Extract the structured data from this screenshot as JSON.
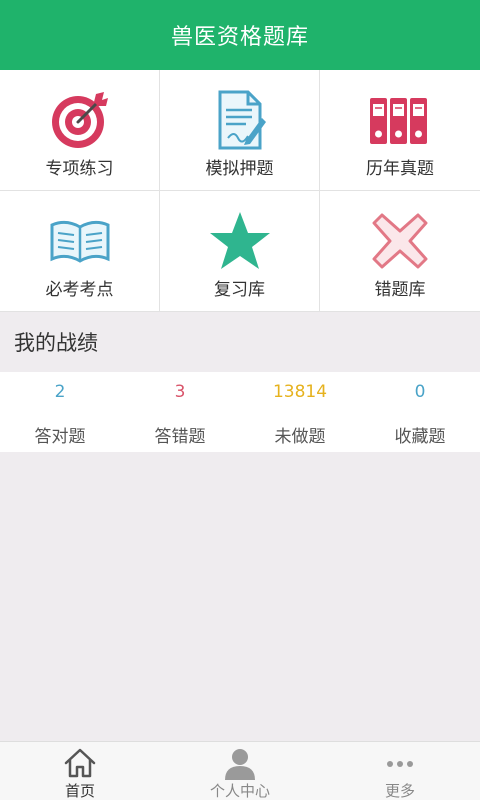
{
  "header": {
    "title": "兽医资格题库"
  },
  "grid": {
    "items": [
      {
        "label": "专项练习",
        "icon": "target-icon"
      },
      {
        "label": "模拟押题",
        "icon": "document-pen-icon"
      },
      {
        "label": "历年真题",
        "icon": "binders-icon"
      },
      {
        "label": "必考考点",
        "icon": "open-book-icon"
      },
      {
        "label": "复习库",
        "icon": "star-icon"
      },
      {
        "label": "错题库",
        "icon": "cross-icon"
      }
    ]
  },
  "record": {
    "title": "我的战绩",
    "stats": [
      {
        "value": "2",
        "label": "答对题",
        "color": "#4aa3c8"
      },
      {
        "value": "3",
        "label": "答错题",
        "color": "#d9546a"
      },
      {
        "value": "13814",
        "label": "未做题",
        "color": "#e6b21e"
      },
      {
        "value": "0",
        "label": "收藏题",
        "color": "#4aa3c8"
      }
    ]
  },
  "nav": {
    "items": [
      {
        "label": "首页",
        "icon": "home-icon",
        "active": true
      },
      {
        "label": "个人中心",
        "icon": "user-icon",
        "active": false
      },
      {
        "label": "更多",
        "icon": "more-dots-icon",
        "active": false
      }
    ]
  },
  "colors": {
    "header": "#1fb36b",
    "accent_red": "#d63a5e",
    "accent_teal": "#2fb58f",
    "accent_blue": "#4aa3c8"
  }
}
